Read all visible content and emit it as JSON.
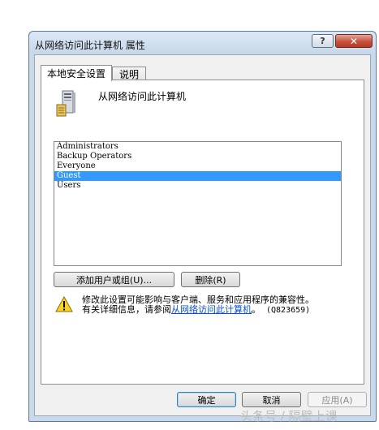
{
  "window": {
    "title": "从网络访问此计算机 属性",
    "help_glyph": "?",
    "close_glyph": "✕"
  },
  "tabs": [
    {
      "label": "本地安全设置",
      "active": true
    },
    {
      "label": "说明",
      "active": false
    }
  ],
  "policy": {
    "name": "从网络访问此计算机",
    "icon": "server-computer-icon"
  },
  "members": [
    {
      "name": "Administrators",
      "selected": false
    },
    {
      "name": "Backup Operators",
      "selected": false
    },
    {
      "name": "Everyone",
      "selected": false
    },
    {
      "name": "Guest",
      "selected": true
    },
    {
      "name": "Users",
      "selected": false
    }
  ],
  "buttons": {
    "add": "添加用户或组(U)...",
    "remove": "删除(R)",
    "ok": "确定",
    "cancel": "取消",
    "apply": "应用(A)"
  },
  "warning": {
    "line1": "修改此设置可能影响与客户端、服务和应用程序的兼容性。",
    "line2_prefix": "有关详细信息，请参阅",
    "link": "从网络访问此计算机",
    "line2_suffix": "。",
    "kb": "(Q823659)",
    "icon": "warning-icon"
  },
  "watermark": "头条号 / 隔壁上课",
  "colors": {
    "selection": "#3399ff",
    "link": "#0a4fcf",
    "close_button": "#c5523f"
  }
}
